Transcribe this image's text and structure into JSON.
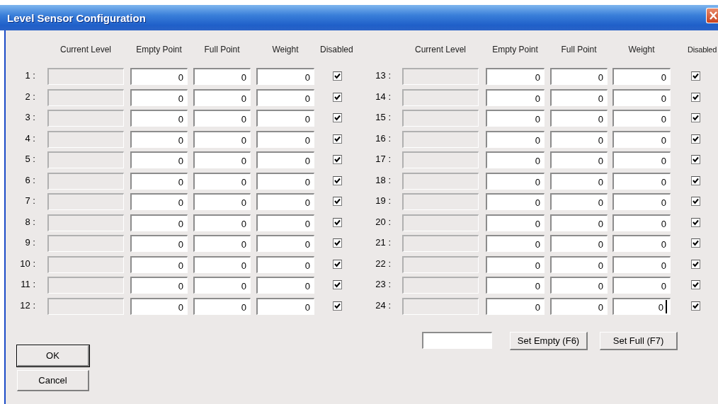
{
  "window": {
    "title": "Level Sensor Configuration"
  },
  "headers_left": [
    "Current Level",
    "Empty Point",
    "Full Point",
    "Weight",
    "Disabled"
  ],
  "headers_right": [
    "Current Level",
    "Empty Point",
    "Full Point",
    "Weight",
    "Disabled"
  ],
  "sensors": [
    {
      "label": "1 :",
      "empty_point": "0",
      "full_point": "0",
      "weight": "0",
      "disabled": true,
      "focused": false
    },
    {
      "label": "2 :",
      "empty_point": "0",
      "full_point": "0",
      "weight": "0",
      "disabled": true,
      "focused": false
    },
    {
      "label": "3 :",
      "empty_point": "0",
      "full_point": "0",
      "weight": "0",
      "disabled": true,
      "focused": false
    },
    {
      "label": "4 :",
      "empty_point": "0",
      "full_point": "0",
      "weight": "0",
      "disabled": true,
      "focused": false
    },
    {
      "label": "5 :",
      "empty_point": "0",
      "full_point": "0",
      "weight": "0",
      "disabled": true,
      "focused": false
    },
    {
      "label": "6 :",
      "empty_point": "0",
      "full_point": "0",
      "weight": "0",
      "disabled": true,
      "focused": false
    },
    {
      "label": "7 :",
      "empty_point": "0",
      "full_point": "0",
      "weight": "0",
      "disabled": true,
      "focused": false
    },
    {
      "label": "8 :",
      "empty_point": "0",
      "full_point": "0",
      "weight": "0",
      "disabled": true,
      "focused": false
    },
    {
      "label": "9 :",
      "empty_point": "0",
      "full_point": "0",
      "weight": "0",
      "disabled": true,
      "focused": false
    },
    {
      "label": "10 :",
      "empty_point": "0",
      "full_point": "0",
      "weight": "0",
      "disabled": true,
      "focused": false
    },
    {
      "label": "11 :",
      "empty_point": "0",
      "full_point": "0",
      "weight": "0",
      "disabled": true,
      "focused": false
    },
    {
      "label": "12 :",
      "empty_point": "0",
      "full_point": "0",
      "weight": "0",
      "disabled": true,
      "focused": false
    },
    {
      "label": "13 :",
      "empty_point": "0",
      "full_point": "0",
      "weight": "0",
      "disabled": true,
      "focused": false
    },
    {
      "label": "14 :",
      "empty_point": "0",
      "full_point": "0",
      "weight": "0",
      "disabled": true,
      "focused": false
    },
    {
      "label": "15 :",
      "empty_point": "0",
      "full_point": "0",
      "weight": "0",
      "disabled": true,
      "focused": false
    },
    {
      "label": "16 :",
      "empty_point": "0",
      "full_point": "0",
      "weight": "0",
      "disabled": true,
      "focused": false
    },
    {
      "label": "17 :",
      "empty_point": "0",
      "full_point": "0",
      "weight": "0",
      "disabled": true,
      "focused": false
    },
    {
      "label": "18 :",
      "empty_point": "0",
      "full_point": "0",
      "weight": "0",
      "disabled": true,
      "focused": false
    },
    {
      "label": "19 :",
      "empty_point": "0",
      "full_point": "0",
      "weight": "0",
      "disabled": true,
      "focused": false
    },
    {
      "label": "20 :",
      "empty_point": "0",
      "full_point": "0",
      "weight": "0",
      "disabled": true,
      "focused": false
    },
    {
      "label": "21 :",
      "empty_point": "0",
      "full_point": "0",
      "weight": "0",
      "disabled": true,
      "focused": false
    },
    {
      "label": "22 :",
      "empty_point": "0",
      "full_point": "0",
      "weight": "0",
      "disabled": true,
      "focused": false
    },
    {
      "label": "23 :",
      "empty_point": "0",
      "full_point": "0",
      "weight": "0",
      "disabled": true,
      "focused": false
    },
    {
      "label": "24 :",
      "empty_point": "0",
      "full_point": "0",
      "weight": "0",
      "disabled": true,
      "focused": true
    }
  ],
  "set_buttons": [
    "Set Empty (F6)",
    "Set Full (F7)"
  ],
  "buttons": [
    {
      "label": "OK",
      "default": true
    },
    {
      "label": "Cancel",
      "default": false
    }
  ]
}
